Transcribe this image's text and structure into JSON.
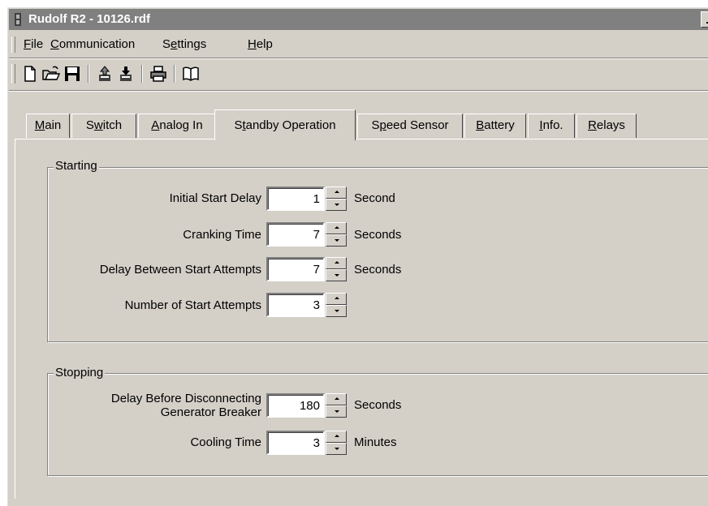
{
  "window": {
    "title": "Rudolf R2 - 10126.rdf"
  },
  "menu": [
    {
      "prefix": "",
      "key": "F",
      "rest": "ile"
    },
    {
      "prefix": "",
      "key": "C",
      "rest": "ommunication"
    },
    {
      "prefix": "S",
      "key": "e",
      "rest": "ttings"
    },
    {
      "prefix": "",
      "key": "H",
      "rest": "elp"
    }
  ],
  "toolbar": {
    "icons": [
      "new-file-icon",
      "open-folder-icon",
      "save-icon",
      "upload-icon",
      "download-icon",
      "print-icon",
      "book-icon"
    ]
  },
  "tabs": [
    {
      "prefix": "",
      "key": "M",
      "rest": "ain"
    },
    {
      "prefix": "S",
      "key": "w",
      "rest": "itch"
    },
    {
      "prefix": "",
      "key": "A",
      "rest": "nalog In"
    },
    {
      "prefix": "S",
      "key": "t",
      "rest": "andby Operation"
    },
    {
      "prefix": "S",
      "key": "p",
      "rest": "eed Sensor"
    },
    {
      "prefix": "",
      "key": "B",
      "rest": "attery"
    },
    {
      "prefix": "",
      "key": "I",
      "rest": "nfo."
    },
    {
      "prefix": "",
      "key": "R",
      "rest": "elays"
    }
  ],
  "active_tab": "Standby Operation",
  "starting": {
    "title": "Starting",
    "fields": [
      {
        "label": "Initial Start Delay",
        "value": "1",
        "unit": "Second"
      },
      {
        "label": "Cranking Time",
        "value": "7",
        "unit": "Seconds"
      },
      {
        "label": "Delay Between Start Attempts",
        "value": "7",
        "unit": "Seconds"
      },
      {
        "label": "Number of Start Attempts",
        "value": "3",
        "unit": ""
      }
    ]
  },
  "stopping": {
    "title": "Stopping",
    "fields": [
      {
        "label_line1": "Delay Before Disconnecting",
        "label_line2": "Generator Breaker",
        "value": "180",
        "unit": "Seconds"
      },
      {
        "label": "Cooling Time",
        "value": "3",
        "unit": "Minutes"
      }
    ]
  }
}
